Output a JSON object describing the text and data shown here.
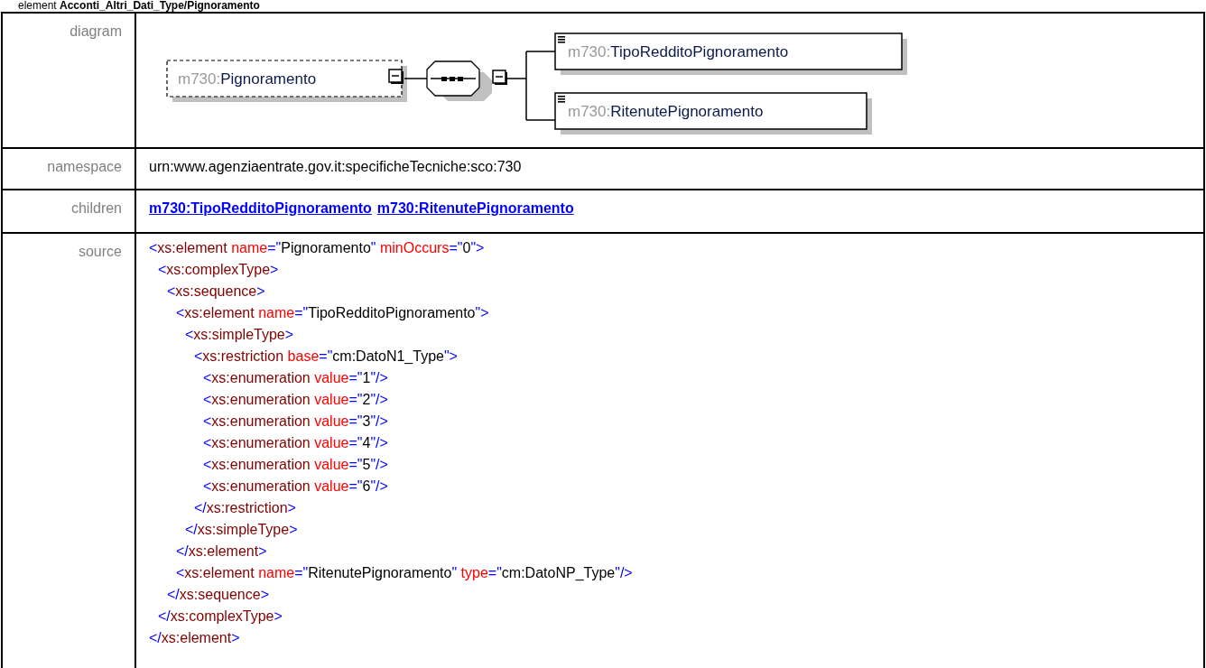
{
  "heading": "element **Acconti_Altri_Dati_Type/Pignoramento**",
  "diagram": {
    "label": "diagram",
    "root": {
      "prefix": "m730:",
      "name": "Pignoramento",
      "optional": true
    },
    "compositor": {
      "kind": "sequence"
    },
    "children": [
      {
        "prefix": "m730:",
        "name": "TipoRedditoPignoramento"
      },
      {
        "prefix": "m730:",
        "name": "RitenutePignoramento"
      }
    ]
  },
  "namespace": {
    "label": "namespace",
    "value": "urn:www.agenziaentrate.gov.it:specificheTecniche:sco:730"
  },
  "children_row": {
    "label": "children",
    "links": [
      "m730:TipoRedditoPignoramento",
      "m730:RitenutePignoramento"
    ]
  },
  "source": {
    "label": "source",
    "lines": [
      {
        "line": [
          {
            "kind": "punct",
            "text": "<"
          },
          {
            "kind": "tag",
            "text": "xs:element"
          },
          {
            "kind": "attr",
            "text": " name"
          },
          {
            "kind": "punct",
            "text": "=\""
          },
          {
            "kind": "value",
            "text": "Pignoramento"
          },
          {
            "kind": "punct",
            "text": "\""
          },
          {
            "kind": "attr",
            "text": " minOccurs"
          },
          {
            "kind": "punct",
            "text": "=\""
          },
          {
            "kind": "value",
            "text": "0"
          },
          {
            "kind": "punct",
            "text": "\">"
          }
        ],
        "children": [
          {
            "line": [
              {
                "kind": "punct",
                "text": "<"
              },
              {
                "kind": "tag",
                "text": "xs:complexType"
              },
              {
                "kind": "punct",
                "text": ">"
              }
            ],
            "children": [
              {
                "line": [
                  {
                    "kind": "punct",
                    "text": "<"
                  },
                  {
                    "kind": "tag",
                    "text": "xs:sequence"
                  },
                  {
                    "kind": "punct",
                    "text": ">"
                  }
                ],
                "children": [
                  {
                    "line": [
                      {
                        "kind": "punct",
                        "text": "<"
                      },
                      {
                        "kind": "tag",
                        "text": "xs:element"
                      },
                      {
                        "kind": "attr",
                        "text": " name"
                      },
                      {
                        "kind": "punct",
                        "text": "=\""
                      },
                      {
                        "kind": "value",
                        "text": "TipoRedditoPignoramento"
                      },
                      {
                        "kind": "punct",
                        "text": "\">"
                      }
                    ],
                    "children": [
                      {
                        "line": [
                          {
                            "kind": "punct",
                            "text": "<"
                          },
                          {
                            "kind": "tag",
                            "text": "xs:simpleType"
                          },
                          {
                            "kind": "punct",
                            "text": ">"
                          }
                        ],
                        "children": [
                          {
                            "line": [
                              {
                                "kind": "punct",
                                "text": "<"
                              },
                              {
                                "kind": "tag",
                                "text": "xs:restriction"
                              },
                              {
                                "kind": "attr",
                                "text": " base"
                              },
                              {
                                "kind": "punct",
                                "text": "=\""
                              },
                              {
                                "kind": "value",
                                "text": "cm:DatoN1_Type"
                              },
                              {
                                "kind": "punct",
                                "text": "\">"
                              }
                            ],
                            "children": [
                              {
                                "line": [
                                  {
                                    "kind": "punct",
                                    "text": "<"
                                  },
                                  {
                                    "kind": "tag",
                                    "text": "xs:enumeration"
                                  },
                                  {
                                    "kind": "attr",
                                    "text": " value"
                                  },
                                  {
                                    "kind": "punct",
                                    "text": "=\""
                                  },
                                  {
                                    "kind": "value",
                                    "text": "1"
                                  },
                                  {
                                    "kind": "punct",
                                    "text": "\"/>"
                                  }
                                ]
                              },
                              {
                                "line": [
                                  {
                                    "kind": "punct",
                                    "text": "<"
                                  },
                                  {
                                    "kind": "tag",
                                    "text": "xs:enumeration"
                                  },
                                  {
                                    "kind": "attr",
                                    "text": " value"
                                  },
                                  {
                                    "kind": "punct",
                                    "text": "=\""
                                  },
                                  {
                                    "kind": "value",
                                    "text": "2"
                                  },
                                  {
                                    "kind": "punct",
                                    "text": "\"/>"
                                  }
                                ]
                              },
                              {
                                "line": [
                                  {
                                    "kind": "punct",
                                    "text": "<"
                                  },
                                  {
                                    "kind": "tag",
                                    "text": "xs:enumeration"
                                  },
                                  {
                                    "kind": "attr",
                                    "text": " value"
                                  },
                                  {
                                    "kind": "punct",
                                    "text": "=\""
                                  },
                                  {
                                    "kind": "value",
                                    "text": "3"
                                  },
                                  {
                                    "kind": "punct",
                                    "text": "\"/>"
                                  }
                                ]
                              },
                              {
                                "line": [
                                  {
                                    "kind": "punct",
                                    "text": "<"
                                  },
                                  {
                                    "kind": "tag",
                                    "text": "xs:enumeration"
                                  },
                                  {
                                    "kind": "attr",
                                    "text": " value"
                                  },
                                  {
                                    "kind": "punct",
                                    "text": "=\""
                                  },
                                  {
                                    "kind": "value",
                                    "text": "4"
                                  },
                                  {
                                    "kind": "punct",
                                    "text": "\"/>"
                                  }
                                ]
                              },
                              {
                                "line": [
                                  {
                                    "kind": "punct",
                                    "text": "<"
                                  },
                                  {
                                    "kind": "tag",
                                    "text": "xs:enumeration"
                                  },
                                  {
                                    "kind": "attr",
                                    "text": " value"
                                  },
                                  {
                                    "kind": "punct",
                                    "text": "=\""
                                  },
                                  {
                                    "kind": "value",
                                    "text": "5"
                                  },
                                  {
                                    "kind": "punct",
                                    "text": "\"/>"
                                  }
                                ]
                              },
                              {
                                "line": [
                                  {
                                    "kind": "punct",
                                    "text": "<"
                                  },
                                  {
                                    "kind": "tag",
                                    "text": "xs:enumeration"
                                  },
                                  {
                                    "kind": "attr",
                                    "text": " value"
                                  },
                                  {
                                    "kind": "punct",
                                    "text": "=\""
                                  },
                                  {
                                    "kind": "value",
                                    "text": "6"
                                  },
                                  {
                                    "kind": "punct",
                                    "text": "\"/>"
                                  }
                                ]
                              }
                            ]
                          },
                          {
                            "line": [
                              {
                                "kind": "punct",
                                "text": "</"
                              },
                              {
                                "kind": "tag",
                                "text": "xs:restriction"
                              },
                              {
                                "kind": "punct",
                                "text": ">"
                              }
                            ]
                          }
                        ]
                      },
                      {
                        "line": [
                          {
                            "kind": "punct",
                            "text": "</"
                          },
                          {
                            "kind": "tag",
                            "text": "xs:simpleType"
                          },
                          {
                            "kind": "punct",
                            "text": ">"
                          }
                        ]
                      }
                    ]
                  },
                  {
                    "line": [
                      {
                        "kind": "punct",
                        "text": "</"
                      },
                      {
                        "kind": "tag",
                        "text": "xs:element"
                      },
                      {
                        "kind": "punct",
                        "text": ">"
                      }
                    ]
                  },
                  {
                    "line": [
                      {
                        "kind": "punct",
                        "text": "<"
                      },
                      {
                        "kind": "tag",
                        "text": "xs:element"
                      },
                      {
                        "kind": "attr",
                        "text": " name"
                      },
                      {
                        "kind": "punct",
                        "text": "=\""
                      },
                      {
                        "kind": "value",
                        "text": "RitenutePignoramento"
                      },
                      {
                        "kind": "punct",
                        "text": "\""
                      },
                      {
                        "kind": "attr",
                        "text": " type"
                      },
                      {
                        "kind": "punct",
                        "text": "=\""
                      },
                      {
                        "kind": "value",
                        "text": "cm:DatoNP_Type"
                      },
                      {
                        "kind": "punct",
                        "text": "\"/>"
                      }
                    ]
                  }
                ]
              },
              {
                "line": [
                  {
                    "kind": "punct",
                    "text": "</"
                  },
                  {
                    "kind": "tag",
                    "text": "xs:sequence"
                  },
                  {
                    "kind": "punct",
                    "text": ">"
                  }
                ]
              }
            ]
          },
          {
            "line": [
              {
                "kind": "punct",
                "text": "</"
              },
              {
                "kind": "tag",
                "text": "xs:complexType"
              },
              {
                "kind": "punct",
                "text": ">"
              }
            ]
          }
        ]
      },
      {
        "line": [
          {
            "kind": "punct",
            "text": "</"
          },
          {
            "kind": "tag",
            "text": "xs:element"
          },
          {
            "kind": "punct",
            "text": ">"
          }
        ]
      }
    ]
  }
}
